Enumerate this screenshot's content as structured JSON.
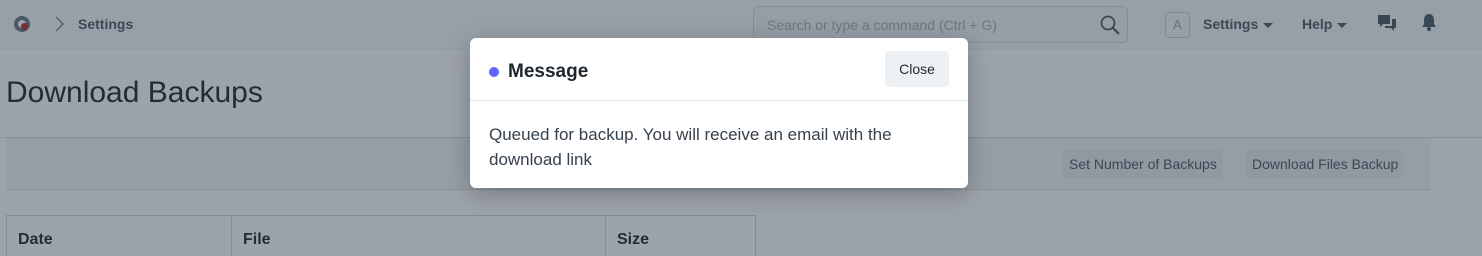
{
  "navbar": {
    "breadcrumb": "Settings",
    "search_placeholder": "Search or type a command (Ctrl + G)",
    "avatar_initial": "A",
    "settings_label": "Settings",
    "help_label": "Help",
    "logo_icon": "frappe-logo-icon",
    "chevron_icon": "chevron-right-icon",
    "search_icon": "search-icon",
    "chat_icon": "chat-icon",
    "bell_icon": "bell-icon"
  },
  "page": {
    "title": "Download Backups",
    "toolbar": {
      "set_number_label": "Set Number of Backups",
      "download_files_label": "Download Files Backup"
    },
    "table": {
      "columns": [
        "Date",
        "File",
        "Size"
      ]
    }
  },
  "modal": {
    "title": "Message",
    "close_label": "Close",
    "message": "Queued for backup. You will receive an email with the download link",
    "indicator_color": "#5e64ff"
  }
}
